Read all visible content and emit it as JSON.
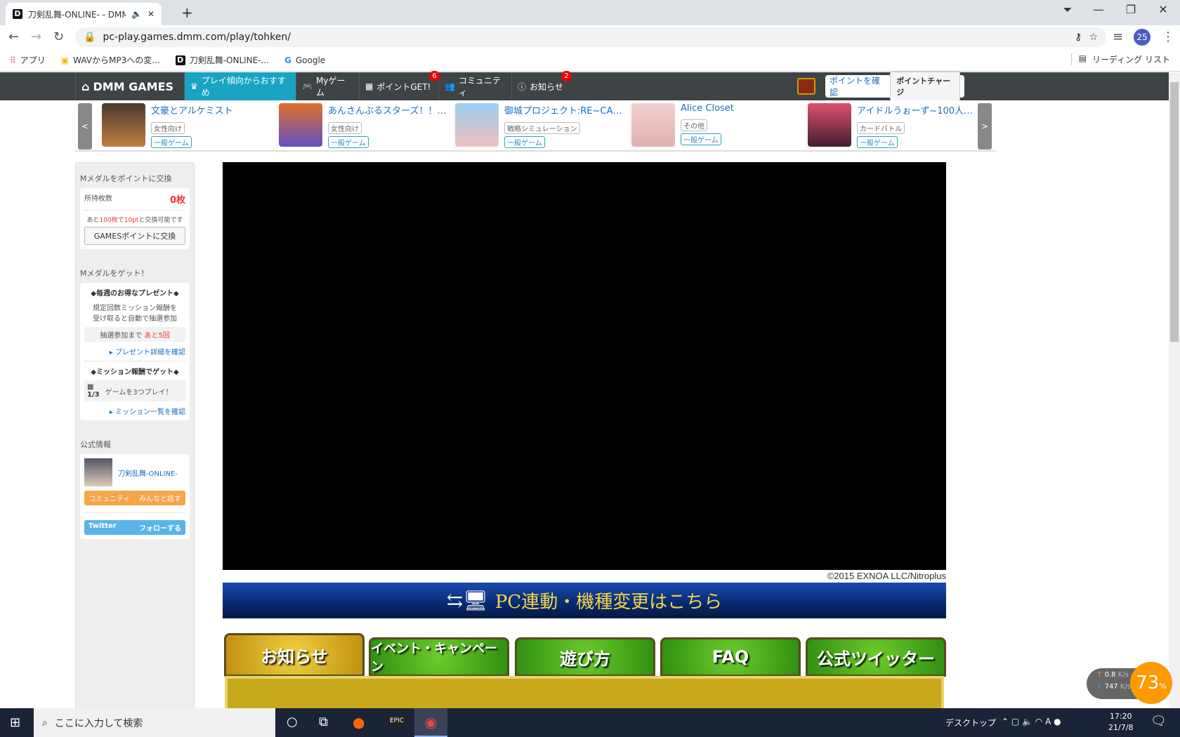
{
  "browser": {
    "tab_title": "刀剣乱舞-ONLINE- - DMM G",
    "url": "pc-play.games.dmm.com/play/tohken/",
    "profile": "25",
    "bookmarks": [
      "アプリ",
      "WAVからMP3への変...",
      "刀剣乱舞-ONLINE-...",
      "Google"
    ],
    "reading_list": "リーディング リスト"
  },
  "nav": {
    "logo": "DMM GAMES",
    "items": [
      "プレイ傾向からおすすめ",
      "Myゲーム",
      "ポイントGET!",
      "コミュニティ",
      "お知らせ"
    ],
    "badges": {
      "points": "6",
      "notice": "2"
    },
    "check_points": "ポイントを確認",
    "charge": "ポイントチャージ",
    "accent": "#1aa3c2"
  },
  "carousel": {
    "prev": "<",
    "next": ">",
    "games": [
      {
        "title": "文豪とアルケミスト",
        "genre": "女性向け",
        "type": "一般ゲーム"
      },
      {
        "title": "あんさんぶるスターズ！！…",
        "genre": "女性向け",
        "type": "一般ゲーム"
      },
      {
        "title": "御城プロジェクト:RE~CA…",
        "genre": "戦略シミュレーション",
        "type": "一般ゲーム"
      },
      {
        "title": "Alice Closet",
        "genre": "その他",
        "type": "一般ゲーム"
      },
      {
        "title": "アイドルうぉーず~100人…",
        "genre": "カードバトル",
        "type": "一般ゲーム"
      }
    ]
  },
  "sidebar": {
    "exchange_title": "Mメダルをポイントに交換",
    "owned_label": "所持枚数",
    "owned": "0枚",
    "remain_pre": "あと",
    "remain_count": "100枚",
    "remain_mid": "で",
    "remain_pt": "10pt",
    "remain_post": "と交換可能です",
    "exchange_btn": "GAMESポイントに交換",
    "get_title": "Mメダルをゲット！",
    "weekly_title": "◆毎週のお得なプレゼント◆",
    "weekly_desc1": "規定回数ミッション報酬を",
    "weekly_desc2": "受け取ると自動で抽選参加",
    "lottery_label": "抽選参加まで",
    "lottery_remain": "あと5回",
    "present_link": "プレゼント詳細を確認",
    "mission_title": "◆ミッション報酬でゲット◆",
    "mission_progress": "1/3",
    "mission_text": "ゲームを3つプレイ！",
    "mission_link": "ミッション一覧を確認",
    "official_title": "公式情報",
    "official_name": "刀剣乱舞-ONLINE-",
    "community": "コミュニティ",
    "community_action": "みんなと話す",
    "twitter": "Twitter",
    "twitter_action": "フォローする"
  },
  "game": {
    "copyright": "©2015 EXNOA LLC/Nitroplus",
    "banner": "PC連動・機種変更はこちら",
    "tabs": [
      "お知らせ",
      "イベント・キャンペーン",
      "遊び方",
      "FAQ",
      "公式ツイッター"
    ]
  },
  "overlay": {
    "up": "0.8",
    "down": "747",
    "unit": "K/s",
    "cpu": "73",
    "cpu_unit": "%"
  },
  "taskbar": {
    "search_placeholder": "ここに入力して検索",
    "desktop": "デスクトップ",
    "time": "17:20",
    "date": "21/7/8"
  }
}
